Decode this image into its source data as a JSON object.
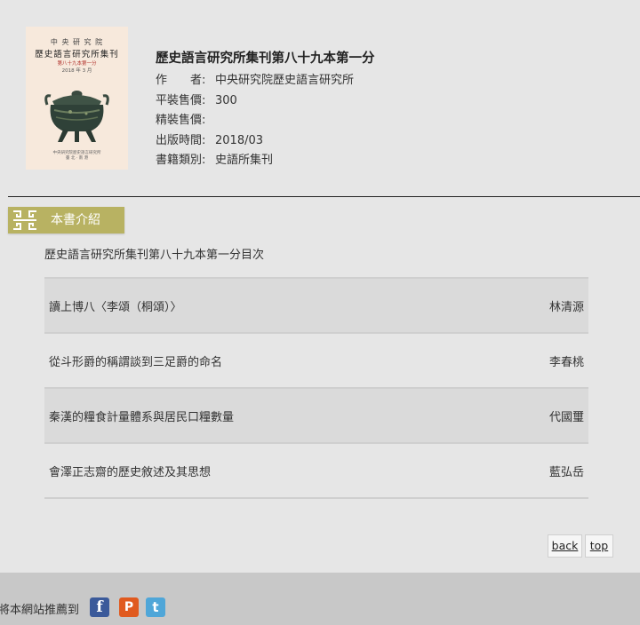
{
  "book": {
    "cover": {
      "line1": "中 央 研 究 院",
      "line2": "歷史語言研究所集刊",
      "line3": "第八十九本第一分",
      "line4": "2018 年 3 月",
      "line5": "中央研究院歷史語言研究所",
      "line6": "臺 北 · 南 港"
    },
    "title": "歷史語言研究所集刊第八十九本第一分",
    "details": [
      {
        "label": "作　　者:",
        "value": "中央研究院歷史語言研究所"
      },
      {
        "label": "平裝售價:",
        "value": "300"
      },
      {
        "label": "精裝售價:",
        "value": ""
      },
      {
        "label": "出版時間:",
        "value": "2018/03"
      },
      {
        "label": "書籍類別:",
        "value": "史語所集刊"
      }
    ]
  },
  "section": {
    "title": "本書介紹"
  },
  "contents": {
    "heading": "歷史語言研究所集刊第八十九本第一分目次",
    "items": [
      {
        "title": "讀上博八〈李頌（桐頌）〉",
        "author": "林清源"
      },
      {
        "title": "從斗形爵的稱謂談到三足爵的命名",
        "author": "李春桃"
      },
      {
        "title": "秦漢的糧食計量體系與居民口糧數量",
        "author": "代國璽"
      },
      {
        "title": "會澤正志齋的歷史敘述及其思想",
        "author": "藍弘岳"
      }
    ]
  },
  "nav": {
    "back": "back",
    "top": "top"
  },
  "footer": {
    "recommend": "將本網站推薦到",
    "icons": [
      "facebook-icon",
      "plurk-icon",
      "twitter-icon"
    ]
  },
  "colors": {
    "tab_bg": "#b8b262",
    "page_bg": "#e6e6e6",
    "footer_bg": "#c8c8c8"
  }
}
